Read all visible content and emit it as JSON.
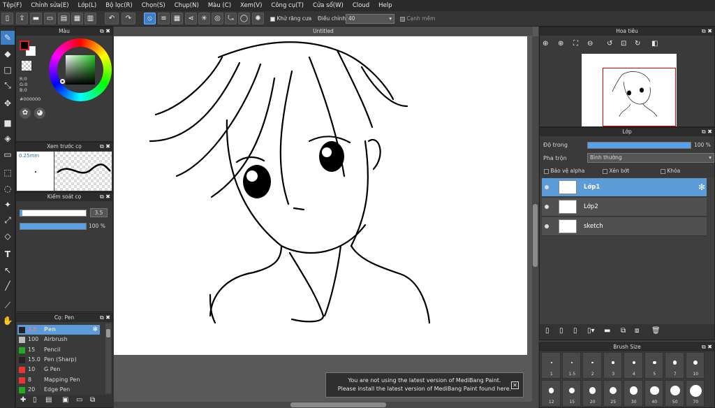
{
  "menu": [
    "Tệp(F)",
    "Chỉnh sửa(E)",
    "Lớp(L)",
    "Bộ lọc(R)",
    "Chọn(S)",
    "Chụp(N)",
    "Màu (C)",
    "Xem(V)",
    "Công cụ(T)",
    "Cửa sổ(W)",
    "Cloud",
    "Help"
  ],
  "toolbar": {
    "antialias_label": "Khử răng cưa",
    "adjust_label": "Điều chỉnh",
    "adjust_value": "40",
    "soft_edge_label": "Cạnh mềm"
  },
  "color_panel": {
    "title": "Màu",
    "r": "R:0",
    "g": "G:0",
    "b": "B:0",
    "hex": "#000000",
    "fg": "#000000",
    "bg": "#ffffff"
  },
  "brush_preview": {
    "title": "Xem trước cọ",
    "size": "0.25mm"
  },
  "brush_control": {
    "title": "Kiểm soát cọ",
    "size": "3.5",
    "opacity": "100 %",
    "opacity_fraction": 1.0
  },
  "brush_list": {
    "title": "Cọ: Pen",
    "items": [
      {
        "size": "3.5",
        "name": "Pen",
        "color": "#222222",
        "selected": true
      },
      {
        "size": "100",
        "name": "Airbrush",
        "color": "#bbbbbb"
      },
      {
        "size": "15",
        "name": "Pencil",
        "color": "#22aa22"
      },
      {
        "size": "15.0",
        "name": "Pen (Sharp)",
        "color": "#222222"
      },
      {
        "size": "10",
        "name": "G Pen",
        "color": "#ee3333"
      },
      {
        "size": "8",
        "name": "Mapping Pen",
        "color": "#ee3333"
      },
      {
        "size": "20",
        "name": "Edge Pen",
        "color": "#22aa22"
      }
    ]
  },
  "canvas": {
    "title": "Untitled"
  },
  "notice": {
    "line1": "You are not using the latest version of MediBang Paint.",
    "line2": "Please install the latest version of MediBang Paint found here."
  },
  "navigator": {
    "title": "Hoa tiêu"
  },
  "layer_panel": {
    "title": "Lớp",
    "opacity_label": "Độ trong",
    "opacity_value": "100 %",
    "opacity_fraction": 1.0,
    "blend_label": "Pha trộn",
    "blend_value": "Bình thường",
    "protect_alpha": "Bảo vệ alpha",
    "clipping": "Xén bớt",
    "lock": "Khóa",
    "layers": [
      {
        "name": "Lớp1",
        "selected": true
      },
      {
        "name": "Lớp2"
      },
      {
        "name": "sketch"
      }
    ]
  },
  "brush_size": {
    "title": "Brush Size",
    "sizes_row1": [
      "1",
      "1.5",
      "2",
      "3",
      "4",
      "5",
      "7",
      "10"
    ],
    "sizes_row2": [
      "12",
      "15",
      "20",
      "25",
      "30",
      "40",
      "50",
      "70"
    ]
  }
}
